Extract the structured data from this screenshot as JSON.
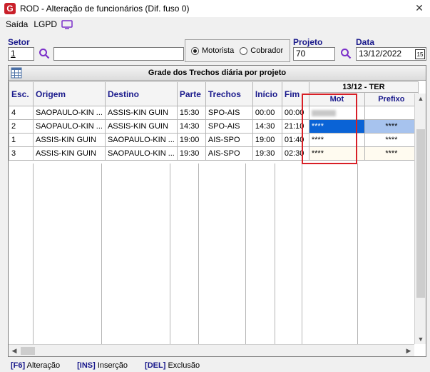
{
  "window": {
    "title": "ROD - Alteração de funcionários (Dif. fuso 0)",
    "logo_letter": "G",
    "close_glyph": "✕"
  },
  "menu": {
    "items": [
      "Saída",
      "LGPD"
    ],
    "lgpd_icon": "monitor-icon"
  },
  "filters": {
    "setor_label": "Setor",
    "setor_value": "1",
    "setor_desc": "",
    "radio_options": [
      "Motorista",
      "Cobrador"
    ],
    "radio_selected": "Motorista",
    "projeto_label": "Projeto",
    "projeto_value": "70",
    "data_label": "Data",
    "data_value": "13/12/2022",
    "calendar_glyph": "15"
  },
  "grid": {
    "title": "Grade dos Trechos diária por projeto",
    "columns": [
      "Esc.",
      "Origem",
      "Destino",
      "Parte",
      "Trechos",
      "Início",
      "Fim"
    ],
    "day_header": "13/12 - TER",
    "sub_columns": [
      "Mot",
      "Prefixo"
    ],
    "rows": [
      {
        "esc": "4",
        "origem": "SAOPAULO-KIN ...",
        "destino": "ASSIS-KIN GUIN",
        "parte": "15:30",
        "trechos": "SPO-AIS",
        "inicio": "00:00",
        "fim": "00:00",
        "mot": "",
        "prefixo": ""
      },
      {
        "esc": "2",
        "origem": "SAOPAULO-KIN ...",
        "destino": "ASSIS-KIN GUIN",
        "parte": "14:30",
        "trechos": "SPO-AIS",
        "inicio": "14:30",
        "fim": "21:10",
        "mot": "****",
        "prefixo": "****"
      },
      {
        "esc": "1",
        "origem": "ASSIS-KIN GUIN",
        "destino": "SAOPAULO-KIN ...",
        "parte": "19:00",
        "trechos": "AIS-SPO",
        "inicio": "19:00",
        "fim": "01:40",
        "mot": "****",
        "prefixo": "****"
      },
      {
        "esc": "3",
        "origem": "ASSIS-KIN GUIN",
        "destino": "SAOPAULO-KIN ...",
        "parte": "19:30",
        "trechos": "AIS-SPO",
        "inicio": "19:30",
        "fim": "02:30",
        "mot": "****",
        "prefixo": "****"
      }
    ]
  },
  "status": {
    "items": [
      {
        "key": "[F6]",
        "label": "Alteração"
      },
      {
        "key": "[INS]",
        "label": "Inserção"
      },
      {
        "key": "[DEL]",
        "label": "Exclusão"
      }
    ]
  },
  "colors": {
    "selection": "#0a63d6",
    "selection_light": "#a7c3ee",
    "highlight_box": "#d81f26",
    "label_blue": "#1a1a8c",
    "search_icon": "#7b2fc9"
  }
}
